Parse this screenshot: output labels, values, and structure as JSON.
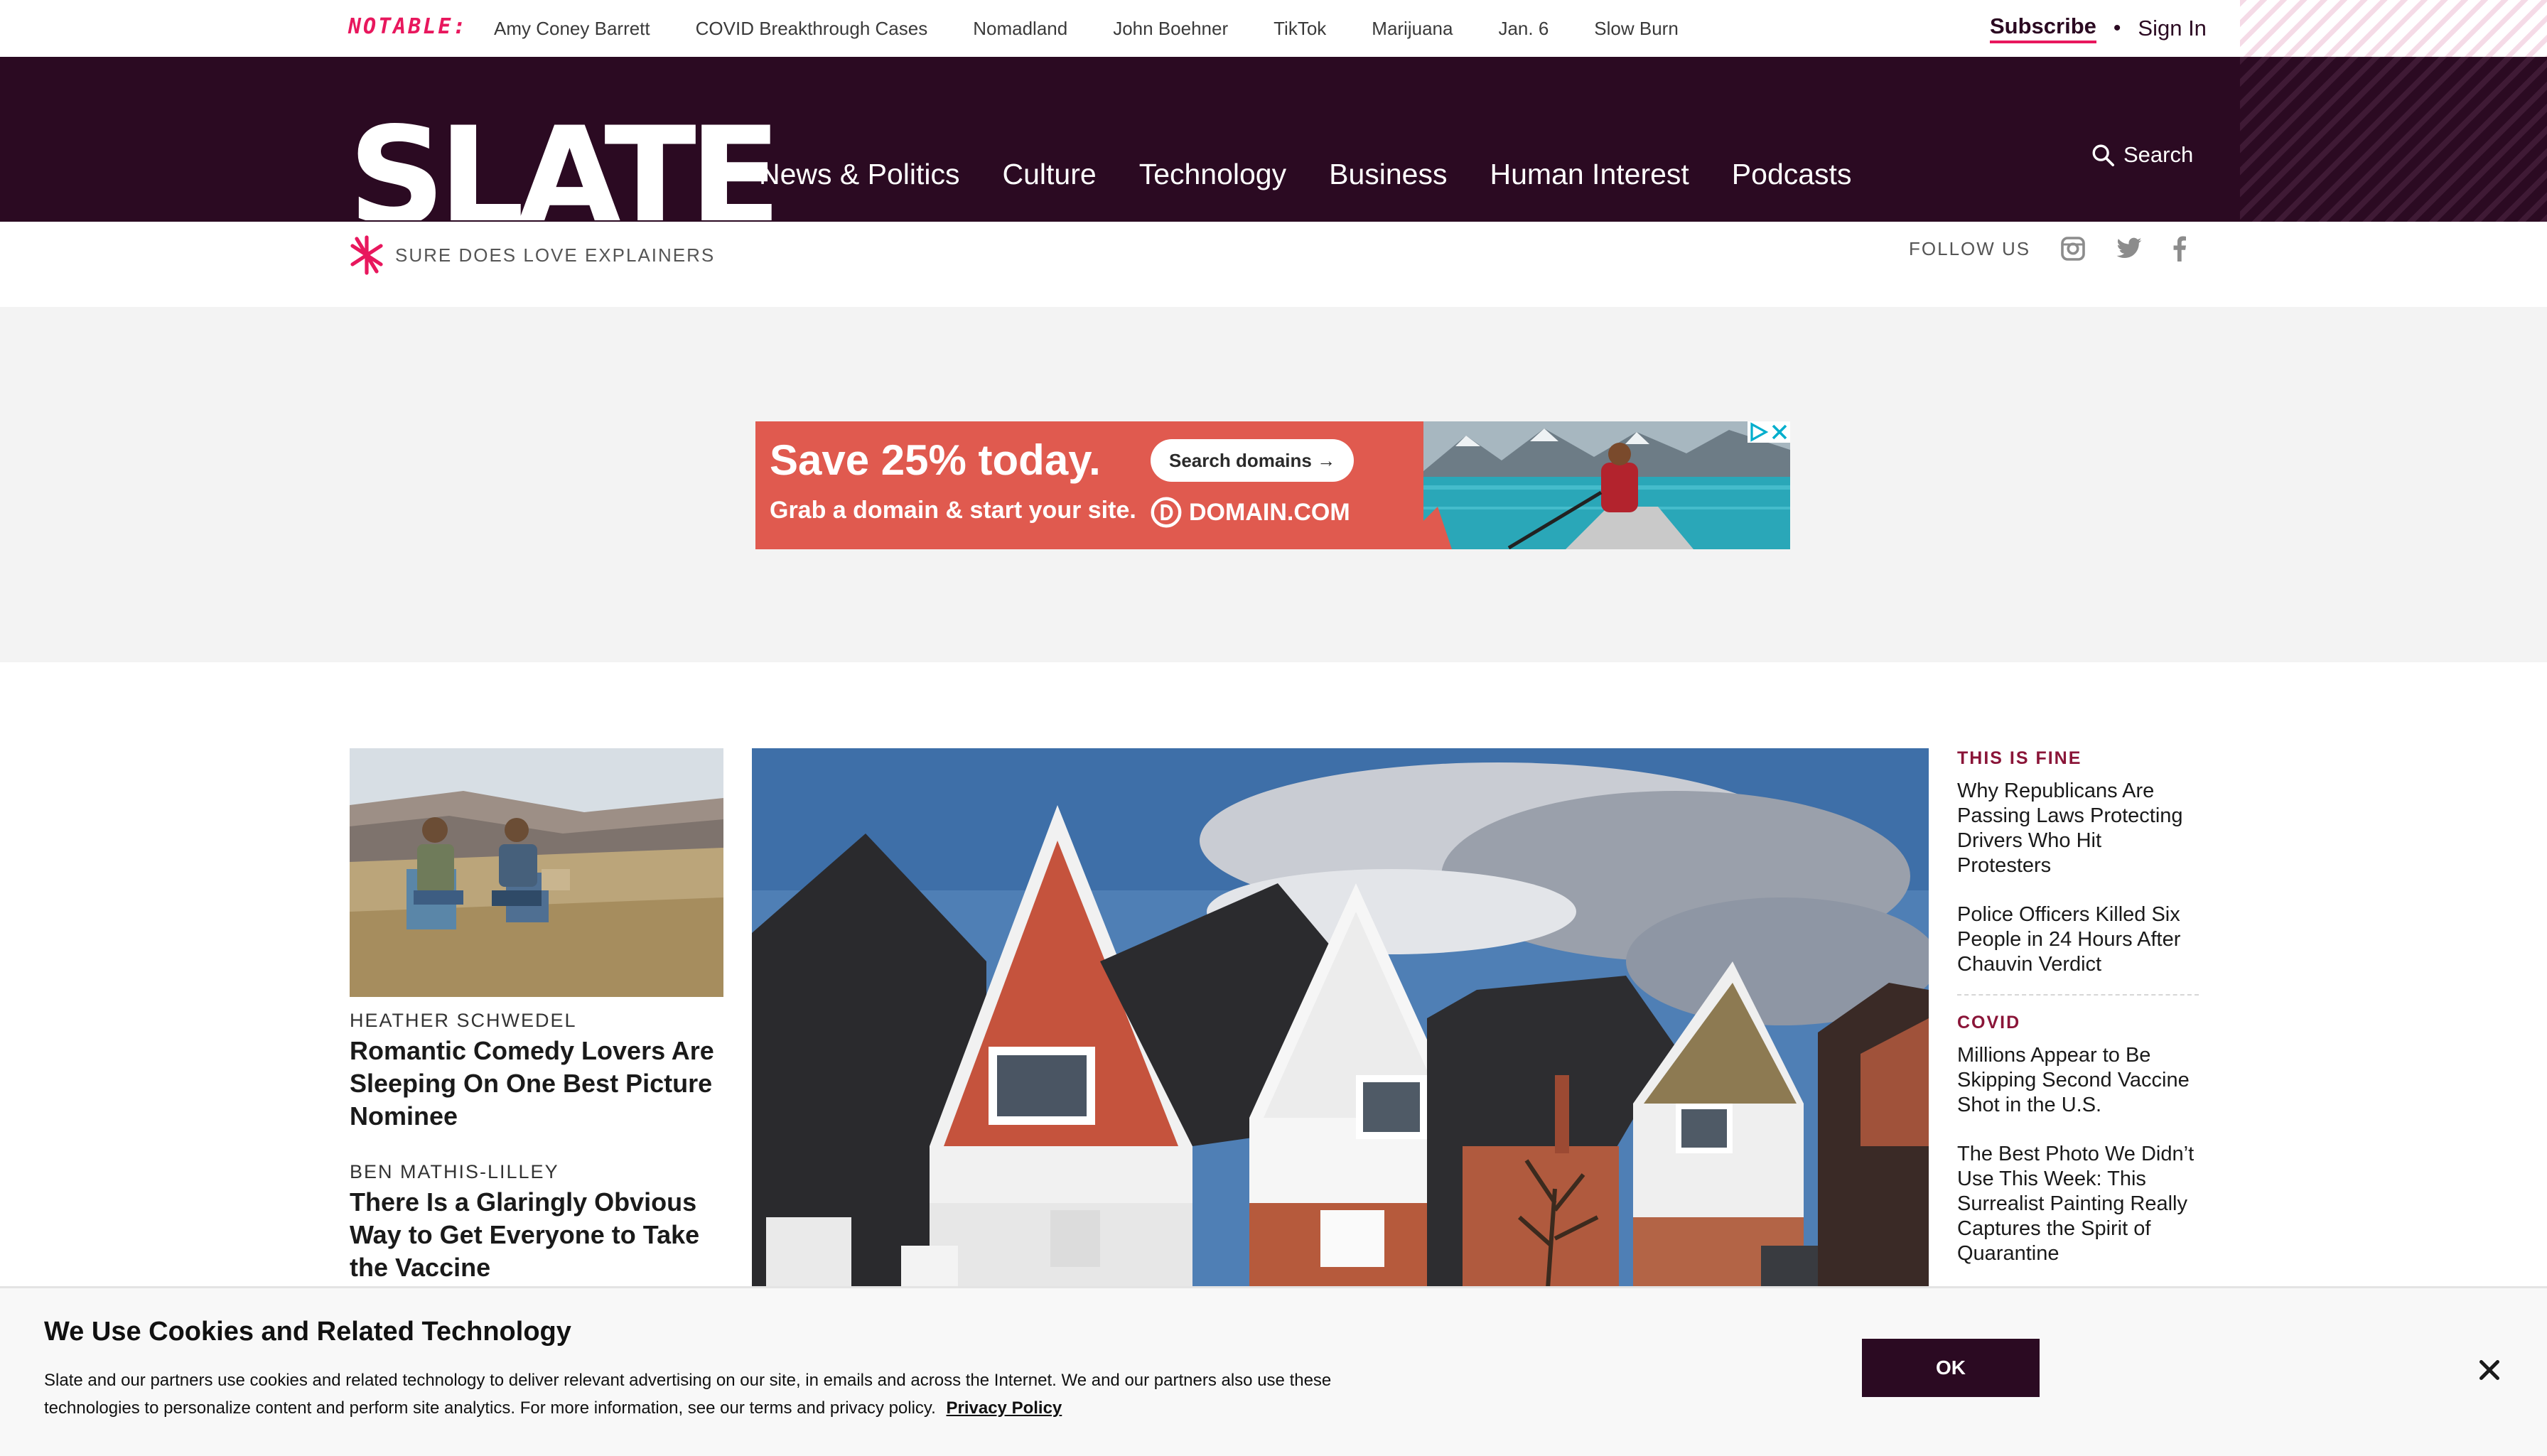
{
  "notable": {
    "label": "NOTABLE:",
    "links": [
      "Amy Coney Barrett",
      "COVID Breakthrough Cases",
      "Nomadland",
      "John Boehner",
      "TikTok",
      "Marijuana",
      "Jan. 6",
      "Slow Burn"
    ]
  },
  "account": {
    "subscribe": "Subscribe",
    "separator": "•",
    "sign_in": "Sign In"
  },
  "header": {
    "logo": "SLATE",
    "nav": [
      "News & Politics",
      "Culture",
      "Technology",
      "Business",
      "Human Interest",
      "Podcasts"
    ],
    "search_label": "Search",
    "tagline": "SURE DOES LOVE EXPLAINERS",
    "follow_label": "FOLLOW US"
  },
  "ad": {
    "headline": "Save 25% today.",
    "subline": "Grab a domain & start your site.",
    "button": "Search domains →",
    "brand": "DOMAIN.COM"
  },
  "left_stories": [
    {
      "byline": "HEATHER SCHWEDEL",
      "headline": "Romantic Comedy Lovers Are Sleeping On One Best Picture Nominee"
    },
    {
      "byline": "BEN MATHIS-LILLEY",
      "headline": "There Is a Glaringly Obvious Way to Get Everyone to Take the Vaccine"
    }
  ],
  "right_sections": [
    {
      "kicker": "THIS IS FINE",
      "stories": [
        "Why Republicans Are Passing Laws Protecting Drivers Who Hit Protesters",
        "Police Officers Killed Six People in 24 Hours After Chauvin Verdict"
      ]
    },
    {
      "kicker": "COVID",
      "stories": [
        "Millions Appear to Be Skipping Second Vaccine Shot in the U.S.",
        "The Best Photo We Didn’t Use This Week: This Surrealist Painting Really Captures the Spirit of Quarantine"
      ]
    }
  ],
  "cookie": {
    "title": "We Use Cookies and Related Technology",
    "body": "Slate and our partners use cookies and related technology to deliver relevant advertising on our site, in emails and across the Internet. We and our partners also use these technologies to personalize content and perform site analytics. For more information, see our terms and privacy policy.",
    "link": "Privacy Policy",
    "ok": "OK"
  },
  "colors": {
    "brand_dark": "#2b0a22",
    "accent_pink": "#e8175d",
    "kicker_red": "#8a1538",
    "ad_red": "#e05a4f"
  }
}
